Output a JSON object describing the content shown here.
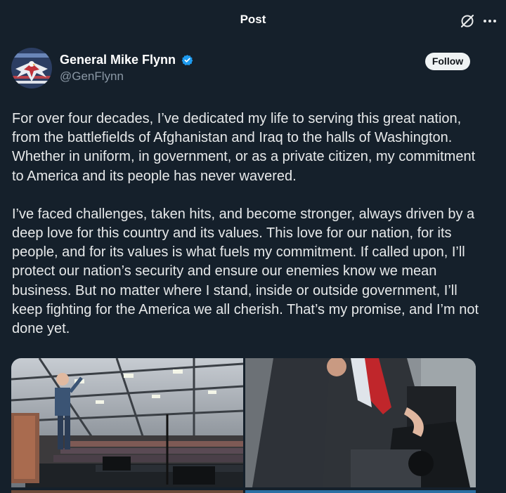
{
  "header": {
    "title": "Post",
    "icons": [
      "grok-icon",
      "more-icon"
    ]
  },
  "author": {
    "display_name": "General Mike Flynn",
    "handle": "@GenFlynn",
    "verified": true,
    "follow_label": "Follow",
    "avatar_icon": "eagle-flag-avatar"
  },
  "post": {
    "paragraphs": [
      "For over four decades, I’ve dedicated my life to serving this great nation, from the battlefields of Afghanistan and Iraq to the halls of Washington. Whether in uniform, in government, or as a private citizen, my commitment to America and its people has never wavered.",
      "I’ve faced challenges, taken hits, and become stronger, always driven by a deep love for this country and its values. This love for our nation, for its people, and for its values is what fuels my commitment. If called upon, I’ll protect our nation’s security and ensure our enemies know we mean business. But no matter where I stand, inside or outside government, I’ll keep fighting for the America we all cherish. That’s my promise, and I’m not done yet."
    ]
  },
  "media": {
    "count": 4,
    "items": [
      "rally-speech-photo",
      "seated-man-photo",
      "photo-3",
      "photo-4"
    ]
  },
  "colors": {
    "background": "#15202b",
    "text": "#e7e9ea",
    "secondary_text": "#8b98a5",
    "verified": "#1d9bf0",
    "follow_bg": "#eff3f4"
  }
}
